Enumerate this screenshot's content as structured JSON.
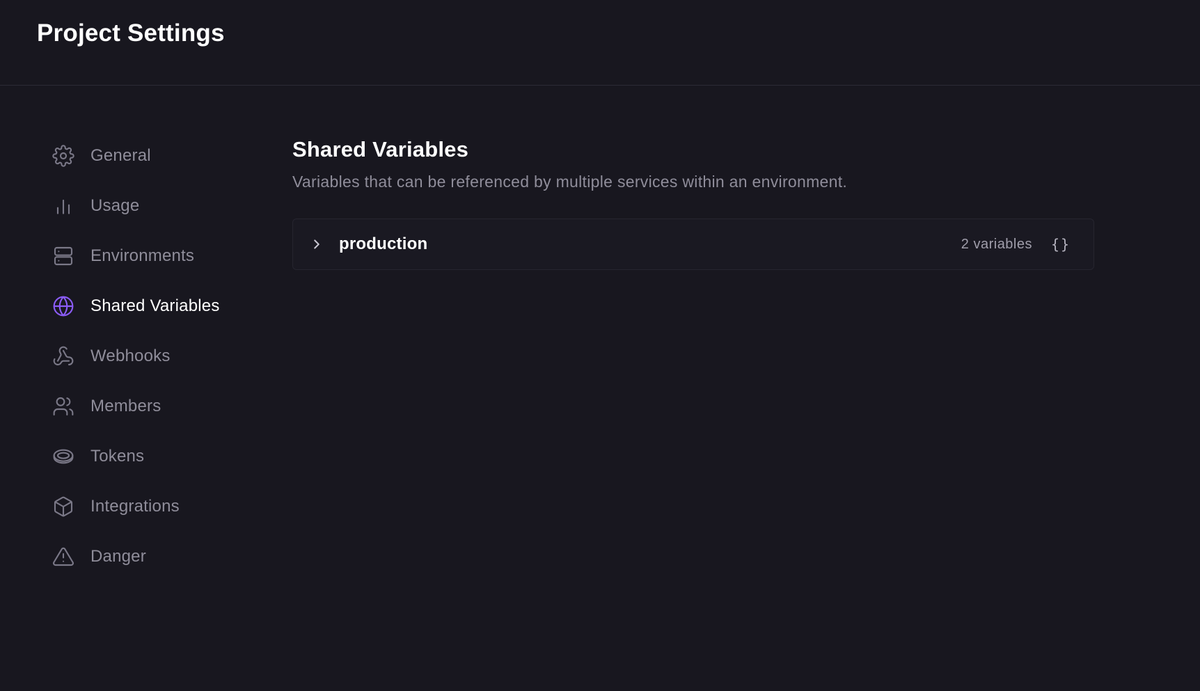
{
  "header": {
    "title": "Project Settings"
  },
  "sidebar": {
    "items": [
      {
        "label": "General",
        "icon": "gear-icon",
        "active": false
      },
      {
        "label": "Usage",
        "icon": "bar-chart-icon",
        "active": false
      },
      {
        "label": "Environments",
        "icon": "server-icon",
        "active": false
      },
      {
        "label": "Shared Variables",
        "icon": "globe-icon",
        "active": true
      },
      {
        "label": "Webhooks",
        "icon": "webhook-icon",
        "active": false
      },
      {
        "label": "Members",
        "icon": "users-icon",
        "active": false
      },
      {
        "label": "Tokens",
        "icon": "token-icon",
        "active": false
      },
      {
        "label": "Integrations",
        "icon": "box-icon",
        "active": false
      },
      {
        "label": "Danger",
        "icon": "warning-icon",
        "active": false
      }
    ]
  },
  "main": {
    "title": "Shared Variables",
    "description": "Variables that can be referenced by multiple services within an environment.",
    "environments": [
      {
        "name": "production",
        "count_label": "2 variables",
        "raw_label": "{}"
      }
    ]
  },
  "colors": {
    "background": "#18171f",
    "accent": "#8b5cf6",
    "text_primary": "#ffffff",
    "text_muted": "#8f8d9a"
  }
}
